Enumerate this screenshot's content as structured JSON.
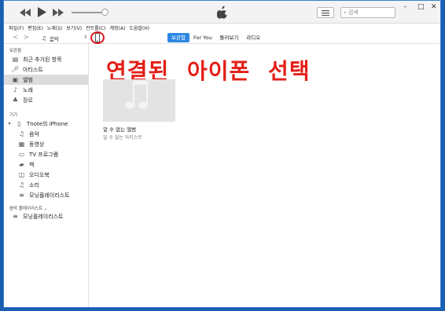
{
  "search": {
    "placeholder": "검색"
  },
  "window_controls": {
    "minimize": "–",
    "maximize": "□",
    "close": "✕"
  },
  "menu": [
    "파일(F)",
    "편집(E)",
    "노래(S)",
    "보기(V)",
    "컨트롤(C)",
    "계정(A)",
    "도움말(H)"
  ],
  "media_kind": {
    "label": "음악"
  },
  "tabs": [
    {
      "label": "보관함",
      "active": true
    },
    {
      "label": "For You",
      "active": false
    },
    {
      "label": "둘러보기",
      "active": false
    },
    {
      "label": "라디오",
      "active": false
    }
  ],
  "sidebar": {
    "library_header": "보관함",
    "library_items": [
      {
        "label": "최근 추가된 항목",
        "icon": "recent-icon"
      },
      {
        "label": "아티스트",
        "icon": "artist-icon"
      },
      {
        "label": "앨범",
        "icon": "album-icon",
        "selected": true
      },
      {
        "label": "노래",
        "icon": "note-icon"
      },
      {
        "label": "장르",
        "icon": "genre-icon"
      }
    ],
    "devices_header": "기기",
    "device": {
      "label": "Tnote의 iPhone"
    },
    "device_items": [
      {
        "label": "음악",
        "icon": "note-icon"
      },
      {
        "label": "동영상",
        "icon": "film-icon"
      },
      {
        "label": "TV 프로그램",
        "icon": "tv-icon"
      },
      {
        "label": "책",
        "icon": "book-icon"
      },
      {
        "label": "오디오북",
        "icon": "audiobook-icon"
      },
      {
        "label": "소리",
        "icon": "bell-icon"
      },
      {
        "label": "모닝플레이리스트",
        "icon": "playlist-icon"
      }
    ],
    "playlists_header": "음악 플레이리스트 ⌄",
    "playlists": [
      {
        "label": "모닝플레이리스트",
        "icon": "playlist-icon"
      }
    ]
  },
  "annotation": {
    "text": "연결된 아이폰 선택",
    "color": "#e41e16"
  },
  "album": {
    "title": "알 수 없는 앨범",
    "artist": "알 수 없는 아티스트"
  },
  "colors": {
    "accent": "#2d87e2",
    "frame": "#1b5fb0"
  }
}
